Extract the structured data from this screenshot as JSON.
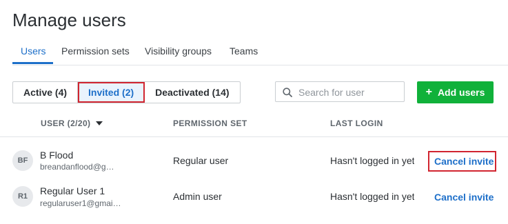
{
  "page_title": "Manage users",
  "tabs": [
    {
      "label": "Users"
    },
    {
      "label": "Permission sets"
    },
    {
      "label": "Visibility groups"
    },
    {
      "label": "Teams"
    }
  ],
  "filters": [
    {
      "label": "Active (4)"
    },
    {
      "label": "Invited (2)"
    },
    {
      "label": "Deactivated (14)"
    }
  ],
  "search": {
    "placeholder": "Search for user",
    "value": ""
  },
  "add_button": {
    "label": "Add users"
  },
  "columns": {
    "user": "USER (2/20)",
    "permission_set": "PERMISSION SET",
    "last_login": "LAST LOGIN"
  },
  "rows": [
    {
      "initials": "BF",
      "name": "B Flood",
      "email": "breandanflood@g…",
      "permission_set": "Regular user",
      "last_login": "Hasn't logged in yet",
      "action": "Cancel invite"
    },
    {
      "initials": "R1",
      "name": "Regular User 1",
      "email": "regularuser1@gmai…",
      "permission_set": "Admin user",
      "last_login": "Hasn't logged in yet",
      "action": "Cancel invite"
    }
  ],
  "colors": {
    "accent": "#1d6fc9",
    "add_button": "#10b13a",
    "highlight": "#d1242f"
  }
}
